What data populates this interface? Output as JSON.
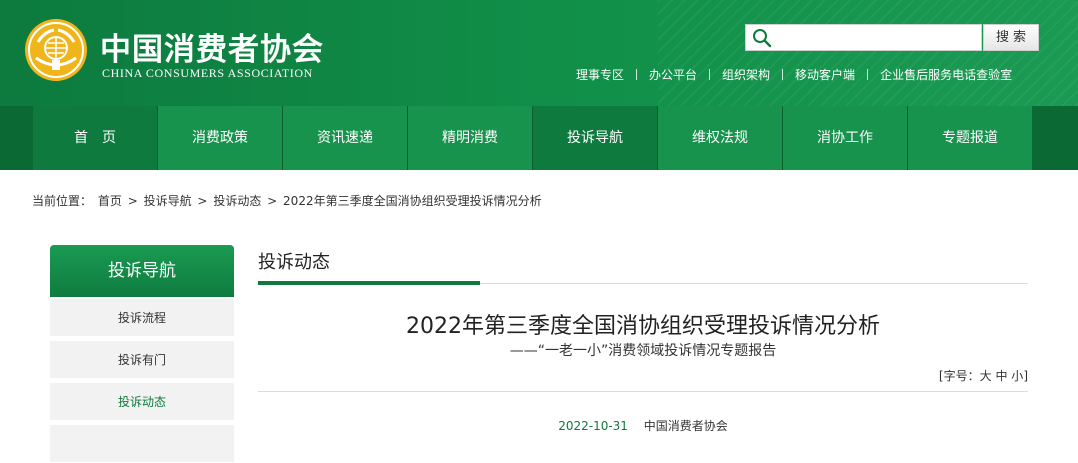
{
  "header": {
    "brand_cn": "中国消费者协会",
    "brand_en": "CHINA CONSUMERS ASSOCIATION",
    "search": {
      "placeholder": "",
      "button_label": "搜索"
    },
    "top_links": [
      "理事专区",
      "办公平台",
      "组织架构",
      "移动客户端",
      "企业售后服务电话查验室"
    ]
  },
  "nav": {
    "items": [
      {
        "label": "首　页"
      },
      {
        "label": "消费政策"
      },
      {
        "label": "资讯速递"
      },
      {
        "label": "精明消费"
      },
      {
        "label": "投诉导航"
      },
      {
        "label": "维权法规"
      },
      {
        "label": "消协工作"
      },
      {
        "label": "专题报道"
      }
    ]
  },
  "breadcrumb": {
    "prefix": "当前位置：",
    "items": [
      "首页",
      "投诉导航",
      "投诉动态",
      "2022年第三季度全国消协组织受理投诉情况分析"
    ]
  },
  "sidebar": {
    "title": "投诉导航",
    "items": [
      {
        "label": "投诉流程"
      },
      {
        "label": "投诉有门"
      },
      {
        "label": "投诉动态"
      }
    ]
  },
  "main": {
    "section_title": "投诉动态",
    "article_title": "2022年第三季度全国消协组织受理投诉情况分析",
    "article_subtitle": "——“一老一小”消费领域投诉情况专题报告",
    "font_size": {
      "open": "[字号：",
      "large": "大",
      "medium": "中",
      "small": "小",
      "close": "]"
    },
    "date": "2022-10-31",
    "source": "中国消费者协会"
  },
  "colors": {
    "brand_green": "#0e7a3e",
    "header_green": "#119049",
    "nav_green": "#17934d",
    "logo_gold": "#f1b51c"
  }
}
